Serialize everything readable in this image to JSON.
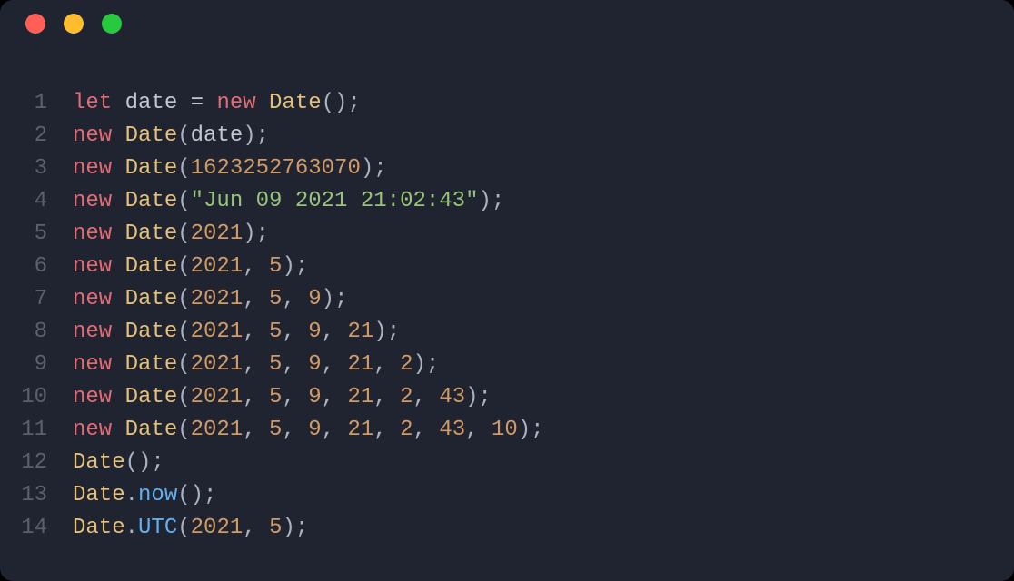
{
  "window": {
    "close": "close",
    "minimize": "minimize",
    "zoom": "zoom"
  },
  "code": {
    "line_numbers": [
      "1",
      "2",
      "3",
      "4",
      "5",
      "6",
      "7",
      "8",
      "9",
      "10",
      "11",
      "12",
      "13",
      "14"
    ],
    "lines": [
      [
        {
          "t": "let ",
          "c": "kw"
        },
        {
          "t": "date ",
          "c": "ident"
        },
        {
          "t": "= ",
          "c": "op"
        },
        {
          "t": "new ",
          "c": "kw"
        },
        {
          "t": "Date",
          "c": "cls"
        },
        {
          "t": "();",
          "c": "punc"
        }
      ],
      [
        {
          "t": "new ",
          "c": "kw"
        },
        {
          "t": "Date",
          "c": "cls"
        },
        {
          "t": "(",
          "c": "punc"
        },
        {
          "t": "date",
          "c": "ident"
        },
        {
          "t": ");",
          "c": "punc"
        }
      ],
      [
        {
          "t": "new ",
          "c": "kw"
        },
        {
          "t": "Date",
          "c": "cls"
        },
        {
          "t": "(",
          "c": "punc"
        },
        {
          "t": "1623252763070",
          "c": "num"
        },
        {
          "t": ");",
          "c": "punc"
        }
      ],
      [
        {
          "t": "new ",
          "c": "kw"
        },
        {
          "t": "Date",
          "c": "cls"
        },
        {
          "t": "(",
          "c": "punc"
        },
        {
          "t": "\"Jun 09 2021 21:02:43\"",
          "c": "str"
        },
        {
          "t": ");",
          "c": "punc"
        }
      ],
      [
        {
          "t": "new ",
          "c": "kw"
        },
        {
          "t": "Date",
          "c": "cls"
        },
        {
          "t": "(",
          "c": "punc"
        },
        {
          "t": "2021",
          "c": "num"
        },
        {
          "t": ");",
          "c": "punc"
        }
      ],
      [
        {
          "t": "new ",
          "c": "kw"
        },
        {
          "t": "Date",
          "c": "cls"
        },
        {
          "t": "(",
          "c": "punc"
        },
        {
          "t": "2021",
          "c": "num"
        },
        {
          "t": ", ",
          "c": "punc"
        },
        {
          "t": "5",
          "c": "num"
        },
        {
          "t": ");",
          "c": "punc"
        }
      ],
      [
        {
          "t": "new ",
          "c": "kw"
        },
        {
          "t": "Date",
          "c": "cls"
        },
        {
          "t": "(",
          "c": "punc"
        },
        {
          "t": "2021",
          "c": "num"
        },
        {
          "t": ", ",
          "c": "punc"
        },
        {
          "t": "5",
          "c": "num"
        },
        {
          "t": ", ",
          "c": "punc"
        },
        {
          "t": "9",
          "c": "num"
        },
        {
          "t": ");",
          "c": "punc"
        }
      ],
      [
        {
          "t": "new ",
          "c": "kw"
        },
        {
          "t": "Date",
          "c": "cls"
        },
        {
          "t": "(",
          "c": "punc"
        },
        {
          "t": "2021",
          "c": "num"
        },
        {
          "t": ", ",
          "c": "punc"
        },
        {
          "t": "5",
          "c": "num"
        },
        {
          "t": ", ",
          "c": "punc"
        },
        {
          "t": "9",
          "c": "num"
        },
        {
          "t": ", ",
          "c": "punc"
        },
        {
          "t": "21",
          "c": "num"
        },
        {
          "t": ");",
          "c": "punc"
        }
      ],
      [
        {
          "t": "new ",
          "c": "kw"
        },
        {
          "t": "Date",
          "c": "cls"
        },
        {
          "t": "(",
          "c": "punc"
        },
        {
          "t": "2021",
          "c": "num"
        },
        {
          "t": ", ",
          "c": "punc"
        },
        {
          "t": "5",
          "c": "num"
        },
        {
          "t": ", ",
          "c": "punc"
        },
        {
          "t": "9",
          "c": "num"
        },
        {
          "t": ", ",
          "c": "punc"
        },
        {
          "t": "21",
          "c": "num"
        },
        {
          "t": ", ",
          "c": "punc"
        },
        {
          "t": "2",
          "c": "num"
        },
        {
          "t": ");",
          "c": "punc"
        }
      ],
      [
        {
          "t": "new ",
          "c": "kw"
        },
        {
          "t": "Date",
          "c": "cls"
        },
        {
          "t": "(",
          "c": "punc"
        },
        {
          "t": "2021",
          "c": "num"
        },
        {
          "t": ", ",
          "c": "punc"
        },
        {
          "t": "5",
          "c": "num"
        },
        {
          "t": ", ",
          "c": "punc"
        },
        {
          "t": "9",
          "c": "num"
        },
        {
          "t": ", ",
          "c": "punc"
        },
        {
          "t": "21",
          "c": "num"
        },
        {
          "t": ", ",
          "c": "punc"
        },
        {
          "t": "2",
          "c": "num"
        },
        {
          "t": ", ",
          "c": "punc"
        },
        {
          "t": "43",
          "c": "num"
        },
        {
          "t": ");",
          "c": "punc"
        }
      ],
      [
        {
          "t": "new ",
          "c": "kw"
        },
        {
          "t": "Date",
          "c": "cls"
        },
        {
          "t": "(",
          "c": "punc"
        },
        {
          "t": "2021",
          "c": "num"
        },
        {
          "t": ", ",
          "c": "punc"
        },
        {
          "t": "5",
          "c": "num"
        },
        {
          "t": ", ",
          "c": "punc"
        },
        {
          "t": "9",
          "c": "num"
        },
        {
          "t": ", ",
          "c": "punc"
        },
        {
          "t": "21",
          "c": "num"
        },
        {
          "t": ", ",
          "c": "punc"
        },
        {
          "t": "2",
          "c": "num"
        },
        {
          "t": ", ",
          "c": "punc"
        },
        {
          "t": "43",
          "c": "num"
        },
        {
          "t": ", ",
          "c": "punc"
        },
        {
          "t": "10",
          "c": "num"
        },
        {
          "t": ");",
          "c": "punc"
        }
      ],
      [
        {
          "t": "Date",
          "c": "cls"
        },
        {
          "t": "();",
          "c": "punc"
        }
      ],
      [
        {
          "t": "Date",
          "c": "cls"
        },
        {
          "t": ".",
          "c": "punc"
        },
        {
          "t": "now",
          "c": "call"
        },
        {
          "t": "();",
          "c": "punc"
        }
      ],
      [
        {
          "t": "Date",
          "c": "cls"
        },
        {
          "t": ".",
          "c": "punc"
        },
        {
          "t": "UTC",
          "c": "call"
        },
        {
          "t": "(",
          "c": "punc"
        },
        {
          "t": "2021",
          "c": "num"
        },
        {
          "t": ", ",
          "c": "punc"
        },
        {
          "t": "5",
          "c": "num"
        },
        {
          "t": ");",
          "c": "punc"
        }
      ]
    ]
  }
}
